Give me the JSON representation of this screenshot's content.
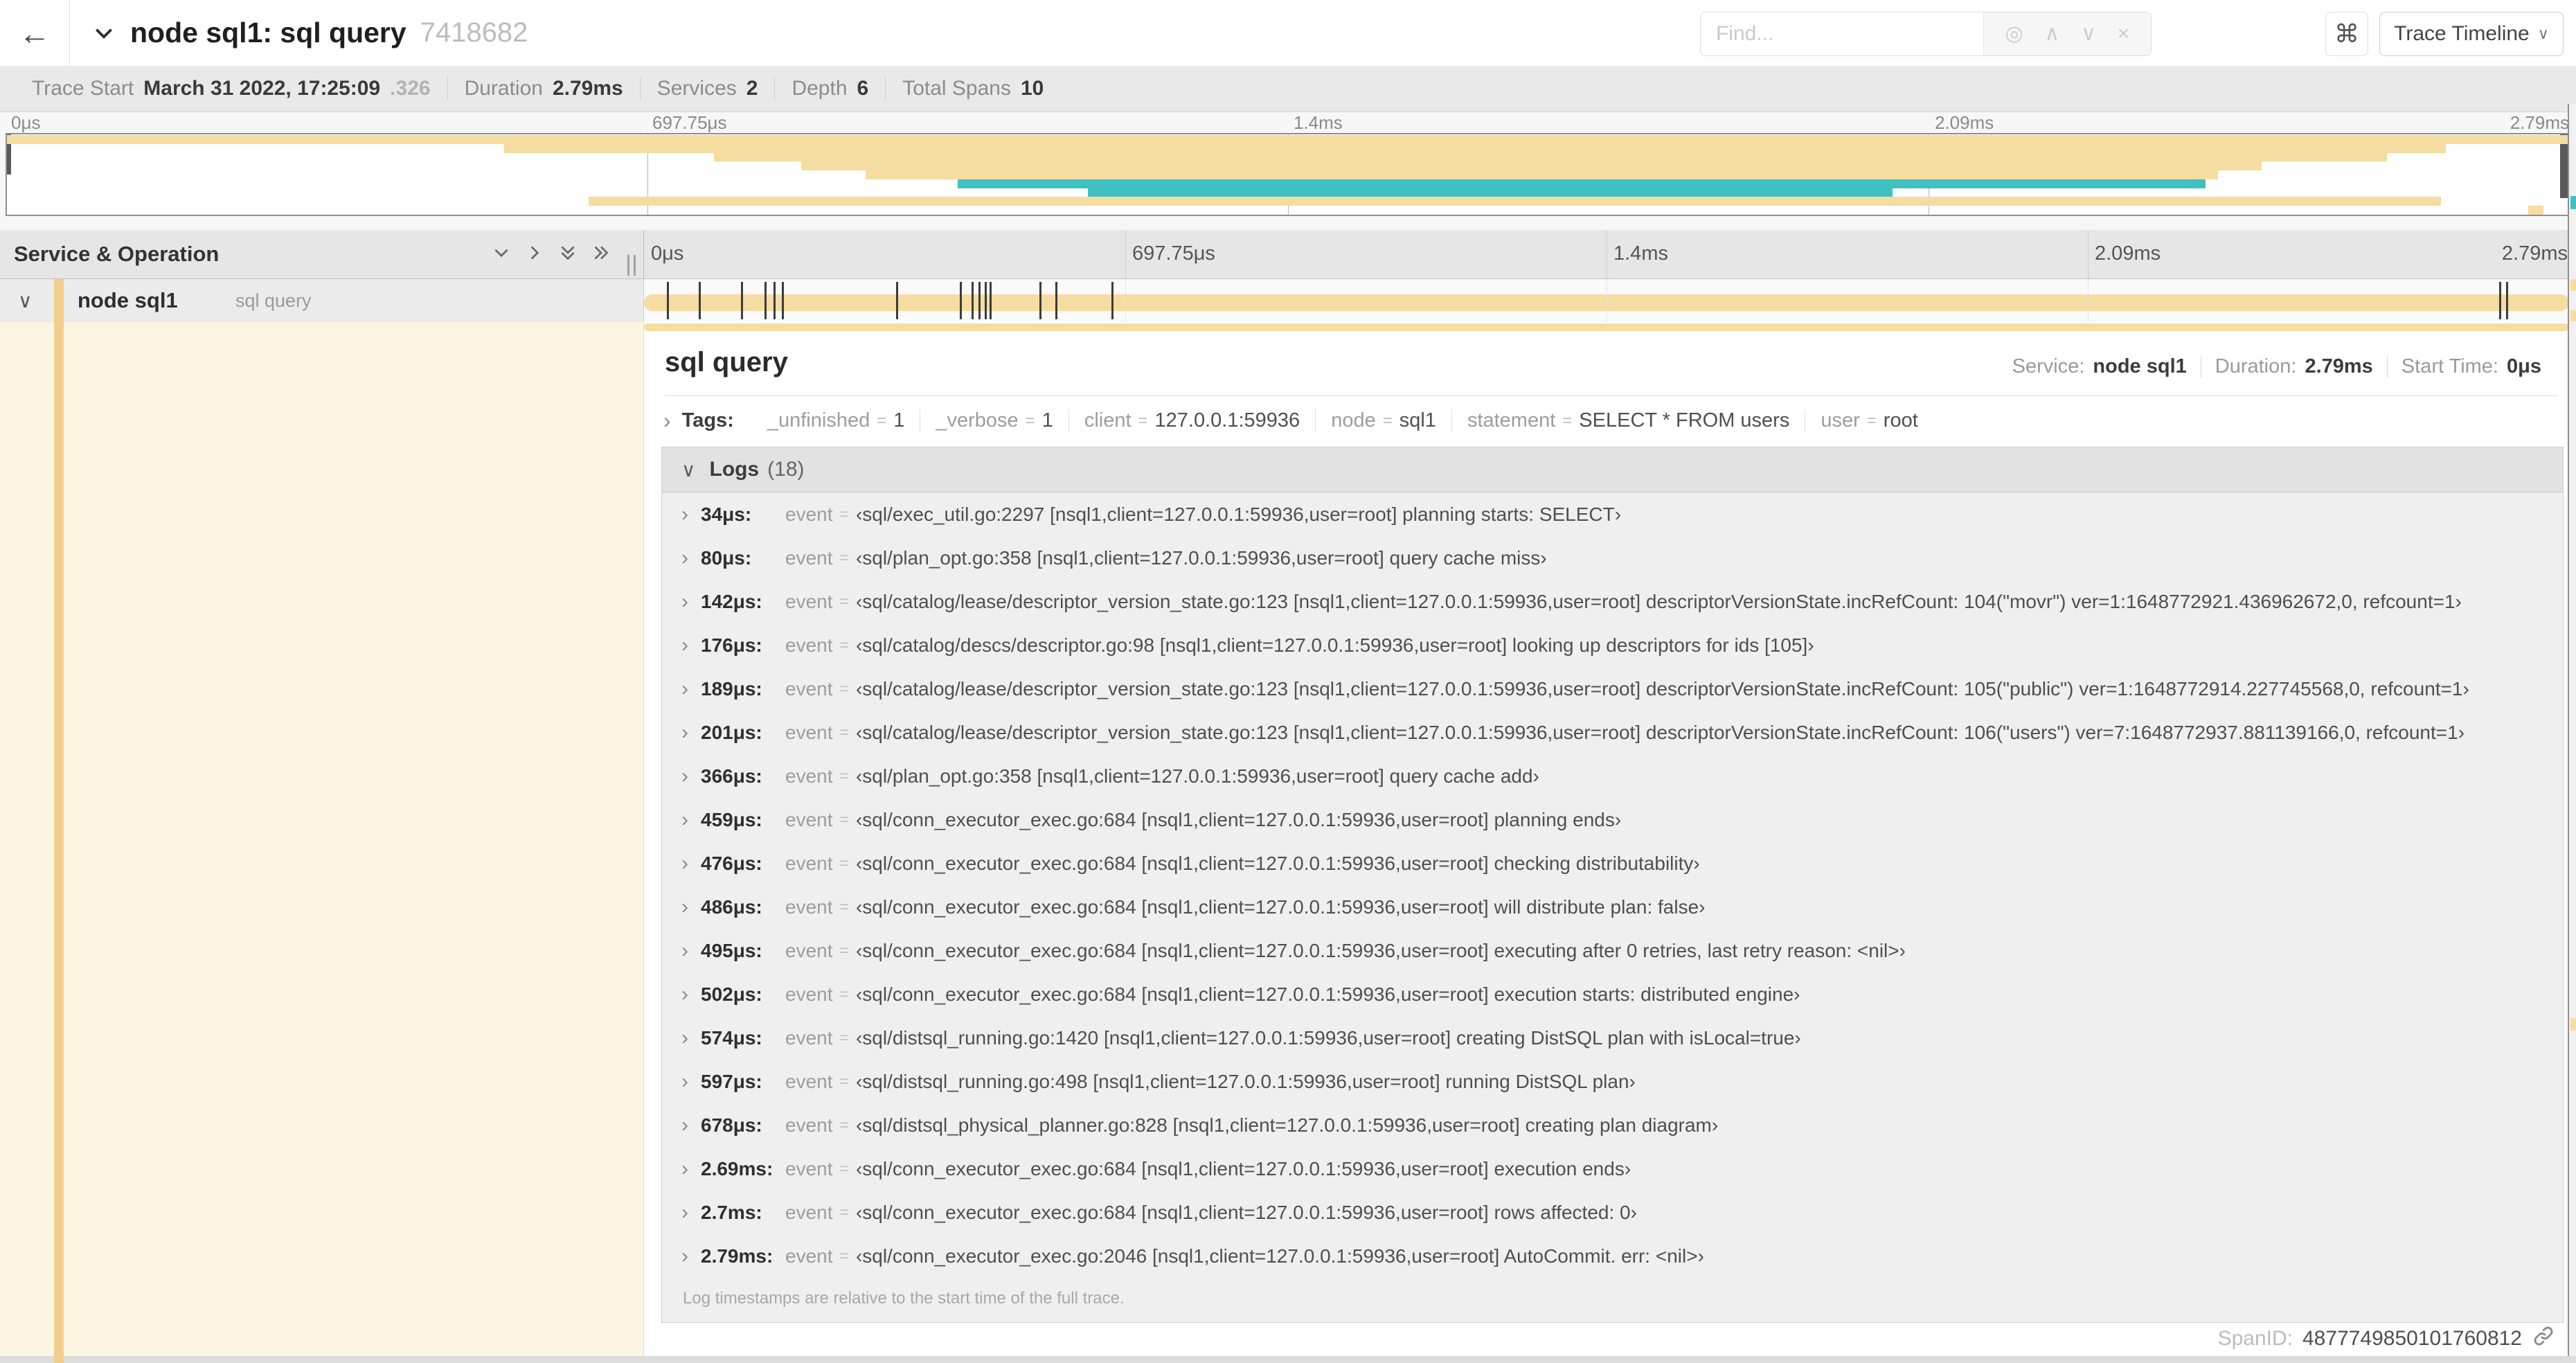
{
  "header": {
    "back_glyph": "←",
    "title": "node sql1: sql query",
    "trace_id": "7418682",
    "find_placeholder": "Find...",
    "find_tools": [
      {
        "name": "locate-icon",
        "glyph": "◎"
      },
      {
        "name": "prev-match-icon",
        "glyph": "∧"
      },
      {
        "name": "next-match-icon",
        "glyph": "∨"
      },
      {
        "name": "clear-icon",
        "glyph": "×"
      }
    ],
    "shortcut_glyph": "⌘",
    "view_selector_label": "Trace Timeline"
  },
  "summary": {
    "items": [
      {
        "label": "Trace Start",
        "value": "March 31 2022, 17:25:09",
        "suffix": ".326"
      },
      {
        "label": "Duration",
        "value": "2.79ms"
      },
      {
        "label": "Services",
        "value": "2"
      },
      {
        "label": "Depth",
        "value": "6"
      },
      {
        "label": "Total Spans",
        "value": "10"
      }
    ]
  },
  "timeline": {
    "duration_us": 2790,
    "labels": [
      {
        "text": "0μs",
        "pct": 0
      },
      {
        "text": "697.75μs",
        "pct": 25
      },
      {
        "text": "1.4ms",
        "pct": 50
      },
      {
        "text": "2.09ms",
        "pct": 75
      },
      {
        "text": "2.79ms",
        "pct": 100
      }
    ]
  },
  "minimap": {
    "rows": [
      {
        "start_pct": 0,
        "end_pct": 100,
        "color": "tan"
      },
      {
        "start_pct": 19.4,
        "end_pct": 95.2,
        "color": "tan"
      },
      {
        "start_pct": 27.6,
        "end_pct": 92.9,
        "color": "tan"
      },
      {
        "start_pct": 31.0,
        "end_pct": 88.0,
        "color": "tan"
      },
      {
        "start_pct": 33.5,
        "end_pct": 86.3,
        "color": "tan"
      },
      {
        "start_pct": 37.1,
        "end_pct": 85.8,
        "color": "teal"
      },
      {
        "start_pct": 42.2,
        "end_pct": 73.6,
        "color": "teal"
      },
      {
        "start_pct": 22.7,
        "end_pct": 95.0,
        "color": "tan"
      },
      {
        "start_pct": 98.4,
        "end_pct": 99.0,
        "color": "tan"
      }
    ]
  },
  "table": {
    "left_header": "Service & Operation"
  },
  "span_row": {
    "service": "node sql1",
    "operation": "sql query"
  },
  "detail": {
    "title": "sql query",
    "meta": [
      {
        "label": "Service:",
        "value": "node sql1"
      },
      {
        "label": "Duration:",
        "value": "2.79ms"
      },
      {
        "label": "Start Time:",
        "value": "0μs"
      }
    ],
    "tags_label": "Tags:",
    "tags": [
      {
        "key": "_unfinished",
        "value": "1"
      },
      {
        "key": "_verbose",
        "value": "1"
      },
      {
        "key": "client",
        "value": "127.0.0.1:59936"
      },
      {
        "key": "node",
        "value": "sql1"
      },
      {
        "key": "statement",
        "value": "SELECT * FROM users"
      },
      {
        "key": "user",
        "value": "root"
      }
    ],
    "logs_label": "Logs",
    "logs_count": "(18)",
    "logs": [
      {
        "time": "34μs:",
        "us": 34,
        "key": "event",
        "value": "‹sql/exec_util.go:2297 [nsql1,client=127.0.0.1:59936,user=root] planning starts: SELECT›"
      },
      {
        "time": "80μs:",
        "us": 80,
        "key": "event",
        "value": "‹sql/plan_opt.go:358 [nsql1,client=127.0.0.1:59936,user=root] query cache miss›"
      },
      {
        "time": "142μs:",
        "us": 142,
        "key": "event",
        "value": "‹sql/catalog/lease/descriptor_version_state.go:123 [nsql1,client=127.0.0.1:59936,user=root] descriptorVersionState.incRefCount: 104(\"movr\") ver=1:1648772921.436962672,0, refcount=1›"
      },
      {
        "time": "176μs:",
        "us": 176,
        "key": "event",
        "value": "‹sql/catalog/descs/descriptor.go:98 [nsql1,client=127.0.0.1:59936,user=root] looking up descriptors for ids [105]›"
      },
      {
        "time": "189μs:",
        "us": 189,
        "key": "event",
        "value": "‹sql/catalog/lease/descriptor_version_state.go:123 [nsql1,client=127.0.0.1:59936,user=root] descriptorVersionState.incRefCount: 105(\"public\") ver=1:1648772914.227745568,0, refcount=1›"
      },
      {
        "time": "201μs:",
        "us": 201,
        "key": "event",
        "value": "‹sql/catalog/lease/descriptor_version_state.go:123 [nsql1,client=127.0.0.1:59936,user=root] descriptorVersionState.incRefCount: 106(\"users\") ver=7:1648772937.881139166,0, refcount=1›"
      },
      {
        "time": "366μs:",
        "us": 366,
        "key": "event",
        "value": "‹sql/plan_opt.go:358 [nsql1,client=127.0.0.1:59936,user=root] query cache add›"
      },
      {
        "time": "459μs:",
        "us": 459,
        "key": "event",
        "value": "‹sql/conn_executor_exec.go:684 [nsql1,client=127.0.0.1:59936,user=root] planning ends›"
      },
      {
        "time": "476μs:",
        "us": 476,
        "key": "event",
        "value": "‹sql/conn_executor_exec.go:684 [nsql1,client=127.0.0.1:59936,user=root] checking distributability›"
      },
      {
        "time": "486μs:",
        "us": 486,
        "key": "event",
        "value": "‹sql/conn_executor_exec.go:684 [nsql1,client=127.0.0.1:59936,user=root] will distribute plan: false›"
      },
      {
        "time": "495μs:",
        "us": 495,
        "key": "event",
        "value": "‹sql/conn_executor_exec.go:684 [nsql1,client=127.0.0.1:59936,user=root] executing after 0 retries, last retry reason: <nil>›"
      },
      {
        "time": "502μs:",
        "us": 502,
        "key": "event",
        "value": "‹sql/conn_executor_exec.go:684 [nsql1,client=127.0.0.1:59936,user=root] execution starts: distributed engine›"
      },
      {
        "time": "574μs:",
        "us": 574,
        "key": "event",
        "value": "‹sql/distsql_running.go:1420 [nsql1,client=127.0.0.1:59936,user=root] creating DistSQL plan with isLocal=true›"
      },
      {
        "time": "597μs:",
        "us": 597,
        "key": "event",
        "value": "‹sql/distsql_running.go:498 [nsql1,client=127.0.0.1:59936,user=root] running DistSQL plan›"
      },
      {
        "time": "678μs:",
        "us": 678,
        "key": "event",
        "value": "‹sql/distsql_physical_planner.go:828 [nsql1,client=127.0.0.1:59936,user=root] creating plan diagram›"
      },
      {
        "time": "2.69ms:",
        "us": 2690,
        "key": "event",
        "value": "‹sql/conn_executor_exec.go:684 [nsql1,client=127.0.0.1:59936,user=root] execution ends›"
      },
      {
        "time": "2.7ms:",
        "us": 2700,
        "key": "event",
        "value": "‹sql/conn_executor_exec.go:684 [nsql1,client=127.0.0.1:59936,user=root] rows affected: 0›"
      },
      {
        "time": "2.79ms:",
        "us": 2790,
        "key": "event",
        "value": "‹sql/conn_executor_exec.go:2046 [nsql1,client=127.0.0.1:59936,user=root] AutoCommit. err: <nil>›"
      }
    ],
    "logs_footnote": "Log timestamps are relative to the start time of the full trace.",
    "span_id_label": "SpanID:",
    "span_id": "4877749850101760812"
  },
  "colors": {
    "tan": "#f5dca1",
    "teal": "#3fc1c1",
    "cream": "#fbf5e2",
    "accent": "#f0cf8e"
  }
}
